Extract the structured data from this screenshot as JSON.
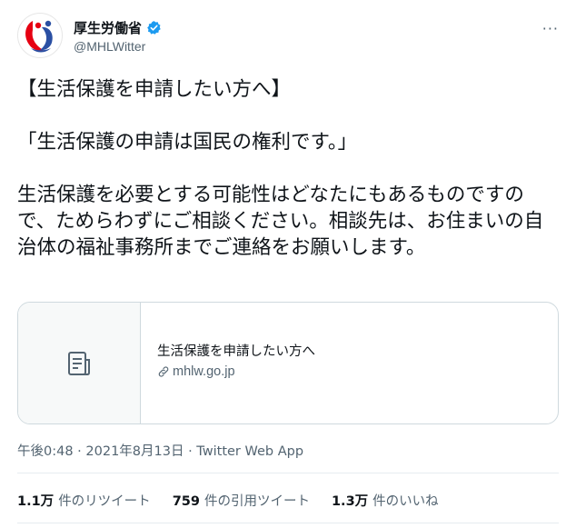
{
  "account": {
    "display_name": "厚生労働省",
    "handle": "@MHLWitter",
    "verified": true,
    "avatar_icon": "mhlw-logo-icon",
    "more_icon": "more-options-icon",
    "more_glyph": "···"
  },
  "tweet": {
    "heading": "【生活保護を申請したい方へ】",
    "quote": "「生活保護の申請は国民の権利です。」",
    "main": "生活保護を必要とする可能性はどなたにもあるものですので、ためらわずにご相談ください。相談先は、お住まいの自治体の福祉事務所までご連絡をお願いします。"
  },
  "link_card": {
    "thumbnail_icon": "document-icon",
    "title": "生活保護を申請したい方へ",
    "domain_icon": "link-icon",
    "domain": "mhlw.go.jp"
  },
  "meta": {
    "time": "午後0:48",
    "separator1": " · ",
    "date": "2021年8月13日",
    "separator2": " · ",
    "app": "Twitter Web App"
  },
  "stats": [
    {
      "number": "1.1万",
      "label": "件のリツイート"
    },
    {
      "number": "759",
      "label": "件の引用ツイート"
    },
    {
      "number": "1.3万",
      "label": "件のいいね"
    }
  ],
  "colors": {
    "text": "#0f1419",
    "secondary": "#536471",
    "verified_blue": "#1d9bf0",
    "border": "#cfd9de",
    "logo_red": "#e60012",
    "logo_blue": "#2a4fa3"
  }
}
